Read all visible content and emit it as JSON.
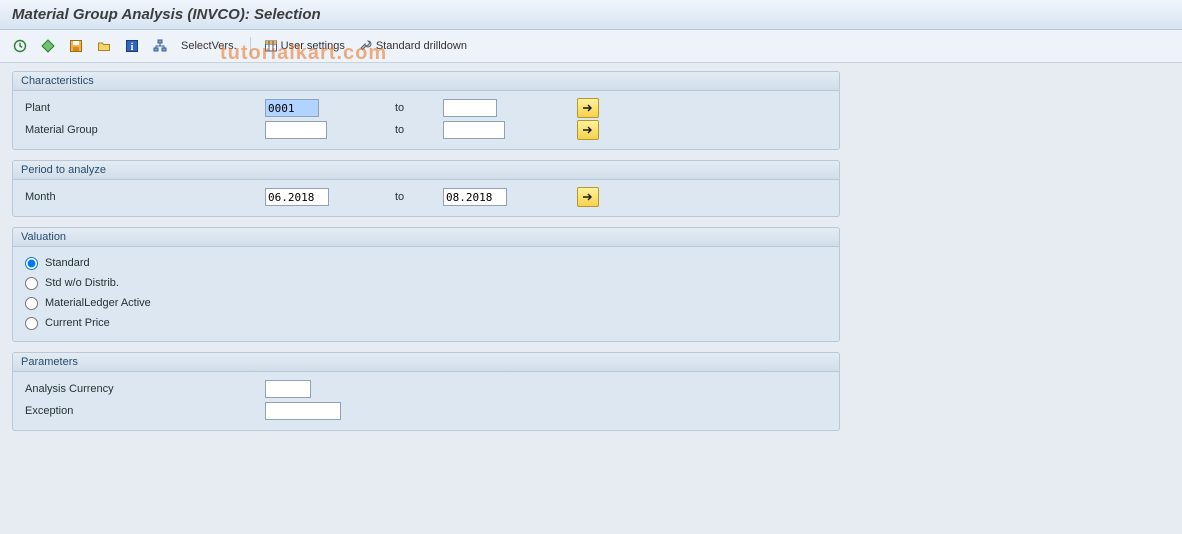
{
  "title": "Material Group Analysis (INVCO): Selection",
  "toolbar": {
    "select_vers": "SelectVers.",
    "user_settings": "User settings",
    "std_drilldown": "Standard drilldown"
  },
  "groups": {
    "characteristics": {
      "title": "Characteristics",
      "plant": {
        "label": "Plant",
        "from": "0001",
        "to_label": "to",
        "to": ""
      },
      "material_group": {
        "label": "Material Group",
        "from": "",
        "to_label": "to",
        "to": ""
      }
    },
    "period": {
      "title": "Period to analyze",
      "month": {
        "label": "Month",
        "from": "06.2018",
        "to_label": "to",
        "to": "08.2018"
      }
    },
    "valuation": {
      "title": "Valuation",
      "options": {
        "standard": "Standard",
        "std_wo_distrib": "Std w/o Distrib.",
        "ml_active": "MaterialLedger Active",
        "current_price": "Current Price"
      },
      "selected": "standard"
    },
    "parameters": {
      "title": "Parameters",
      "analysis_currency": {
        "label": "Analysis Currency",
        "value": ""
      },
      "exception": {
        "label": "Exception",
        "value": ""
      }
    }
  },
  "watermark": "tutorialkart.com"
}
